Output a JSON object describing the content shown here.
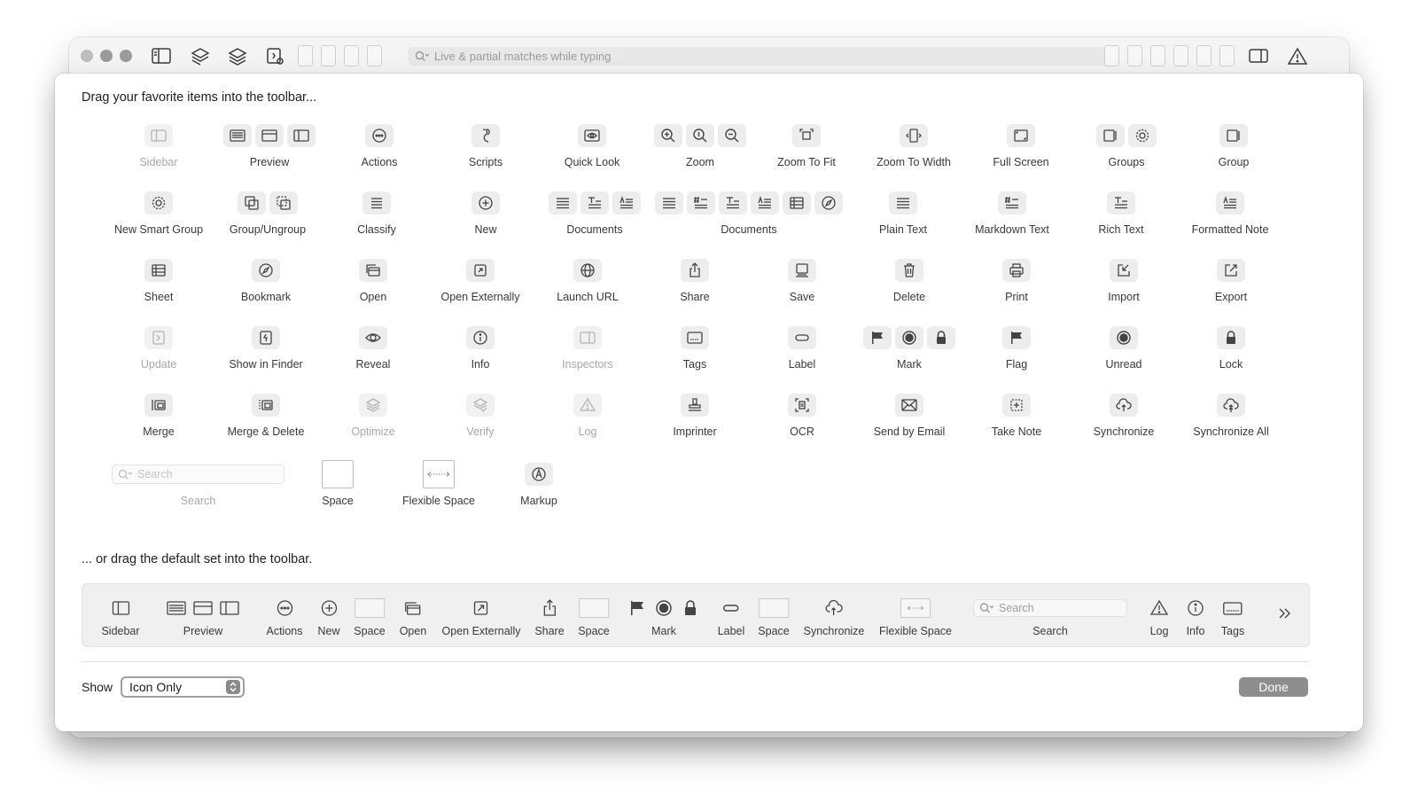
{
  "titlebar": {
    "search_placeholder": "Live & partial matches while typing"
  },
  "sheet": {
    "heading_favorites": "Drag your favorite items into the toolbar...",
    "heading_default": "... or drag the default set into the toolbar."
  },
  "items": [
    {
      "label": "Sidebar"
    },
    {
      "label": "Preview"
    },
    {
      "label": "Actions"
    },
    {
      "label": "Scripts"
    },
    {
      "label": "Quick Look"
    },
    {
      "label": "Zoom"
    },
    {
      "label": "Zoom To Fit"
    },
    {
      "label": "Zoom To Width"
    },
    {
      "label": "Full Screen"
    },
    {
      "label": "Groups"
    },
    {
      "label": "Group"
    },
    {
      "label": "New Smart Group"
    },
    {
      "label": "Group/Ungroup"
    },
    {
      "label": "Classify"
    },
    {
      "label": "New"
    },
    {
      "label": "Documents"
    },
    {
      "label": "Documents"
    },
    {
      "label": "Plain Text"
    },
    {
      "label": "Markdown Text"
    },
    {
      "label": "Rich Text"
    },
    {
      "label": "Formatted Note"
    },
    {
      "label": "Sheet"
    },
    {
      "label": "Bookmark"
    },
    {
      "label": "Open"
    },
    {
      "label": "Open Externally"
    },
    {
      "label": "Launch URL"
    },
    {
      "label": "Share"
    },
    {
      "label": "Save"
    },
    {
      "label": "Delete"
    },
    {
      "label": "Print"
    },
    {
      "label": "Import"
    },
    {
      "label": "Export"
    },
    {
      "label": "Update"
    },
    {
      "label": "Show in Finder"
    },
    {
      "label": "Reveal"
    },
    {
      "label": "Info"
    },
    {
      "label": "Inspectors"
    },
    {
      "label": "Tags"
    },
    {
      "label": "Label"
    },
    {
      "label": "Mark"
    },
    {
      "label": "Flag"
    },
    {
      "label": "Unread"
    },
    {
      "label": "Lock"
    },
    {
      "label": "Merge"
    },
    {
      "label": "Merge & Delete"
    },
    {
      "label": "Optimize"
    },
    {
      "label": "Verify"
    },
    {
      "label": "Log"
    },
    {
      "label": "Imprinter"
    },
    {
      "label": "OCR"
    },
    {
      "label": "Send by Email"
    },
    {
      "label": "Take Note"
    },
    {
      "label": "Synchronize"
    },
    {
      "label": "Synchronize All"
    },
    {
      "label": "Search"
    },
    {
      "label": "Space"
    },
    {
      "label": "Flexible Space"
    },
    {
      "label": "Markup"
    }
  ],
  "search_item_placeholder": "Search",
  "default_set": [
    {
      "label": "Sidebar"
    },
    {
      "label": "Preview"
    },
    {
      "label": "Actions"
    },
    {
      "label": "New"
    },
    {
      "label": "Space"
    },
    {
      "label": "Open"
    },
    {
      "label": "Open Externally"
    },
    {
      "label": "Share"
    },
    {
      "label": "Space"
    },
    {
      "label": "Mark"
    },
    {
      "label": "Label"
    },
    {
      "label": "Space"
    },
    {
      "label": "Synchronize"
    },
    {
      "label": "Flexible Space"
    },
    {
      "label": "Search"
    },
    {
      "label": "Log"
    },
    {
      "label": "Info"
    },
    {
      "label": "Tags"
    }
  ],
  "default_search_placeholder": "Search",
  "footer": {
    "show_label": "Show",
    "show_value": "Icon Only",
    "done_label": "Done"
  }
}
